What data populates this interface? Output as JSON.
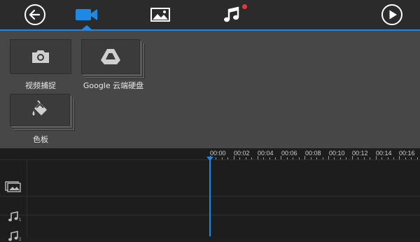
{
  "toolbar": {
    "back_icon": "arrow-left-circle-icon",
    "tabs": [
      {
        "id": "video",
        "icon": "video-camera-icon",
        "active": true
      },
      {
        "id": "image",
        "icon": "image-icon",
        "active": false
      },
      {
        "id": "audio",
        "icon": "music-note-icon",
        "active": false,
        "badge": true
      }
    ],
    "play_icon": "play-circle-icon",
    "accent_color": "#1e88e5",
    "badge_color": "#e53935"
  },
  "media_panel": {
    "tiles": [
      {
        "label": "视频捕捉",
        "icon": "camera-icon"
      },
      {
        "label": "Google 云端硬盘",
        "icon": "google-drive-icon"
      },
      {
        "label": "色板",
        "icon": "paint-bucket-icon"
      }
    ]
  },
  "timeline": {
    "time_labels": [
      "00:00",
      "00:02",
      "00:04",
      "00:06",
      "00:08",
      "00:10",
      "00:12",
      "00:14",
      "00:16"
    ],
    "tracks": [
      {
        "icon": "image-layer-icon",
        "number": ""
      },
      {
        "icon": "music-note-icon",
        "number": "1"
      },
      {
        "icon": "music-note-icon",
        "number": "2"
      }
    ],
    "playhead_time": "00:00"
  }
}
